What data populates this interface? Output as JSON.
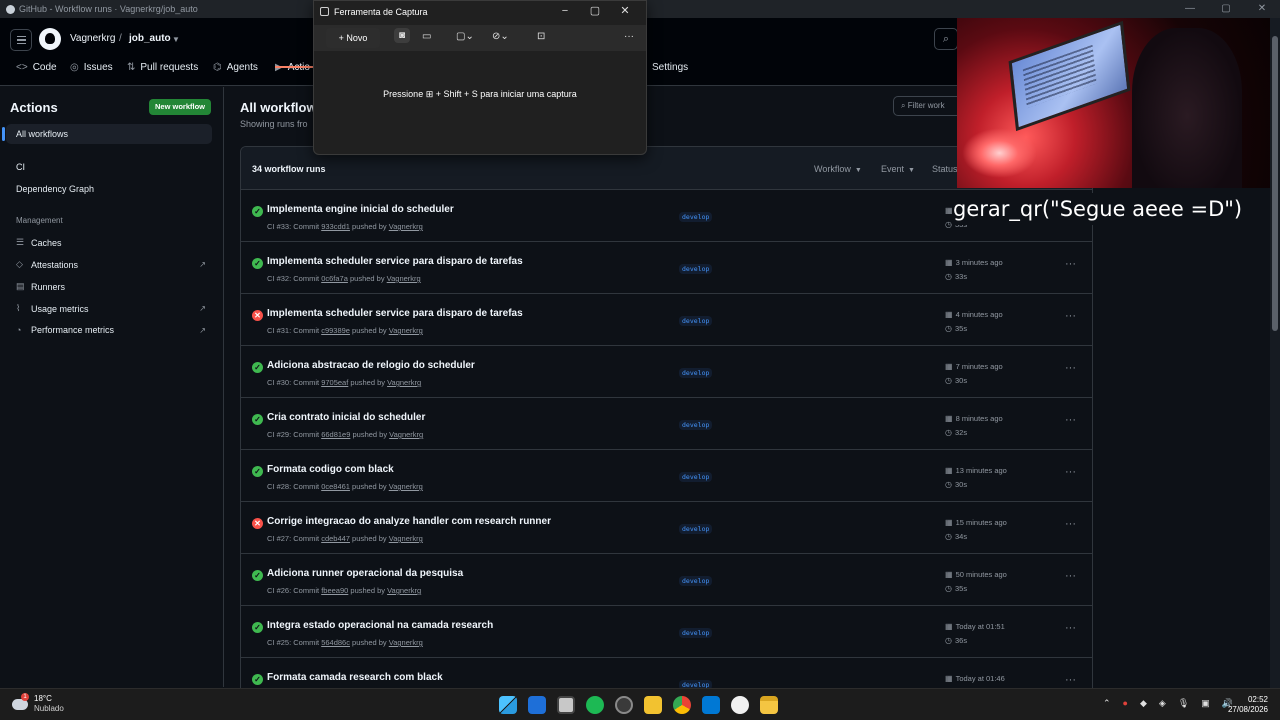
{
  "browser": {
    "tab_title": "GitHub - Workflow runs · Vagnerkrg/job_auto",
    "controls": [
      "—",
      "▢",
      "✕"
    ]
  },
  "header": {
    "owner": "Vagnerkrg",
    "slash": "/",
    "repo": "job_auto",
    "nav": [
      {
        "label": "Code",
        "icon": "code-icon"
      },
      {
        "label": "Issues",
        "icon": "issue-icon"
      },
      {
        "label": "Pull requests",
        "icon": "pull-request-icon"
      },
      {
        "label": "Agents",
        "icon": "agent-icon"
      },
      {
        "label": "Actio",
        "icon": "play-icon"
      },
      {
        "label": "Settings",
        "icon": "gear-icon"
      }
    ]
  },
  "sidebar": {
    "title": "Actions",
    "new_workflow": "New workflow",
    "all_workflows": "All workflows",
    "workflows": [
      "CI",
      "Dependency Graph"
    ],
    "management_label": "Management",
    "management": [
      {
        "label": "Caches",
        "icon": "database-icon",
        "external": false
      },
      {
        "label": "Attestations",
        "icon": "shield-check-icon",
        "external": true
      },
      {
        "label": "Runners",
        "icon": "server-icon",
        "external": false
      },
      {
        "label": "Usage metrics",
        "icon": "graph-icon",
        "external": true
      },
      {
        "label": "Performance metrics",
        "icon": "pulse-icon",
        "external": true
      }
    ]
  },
  "main": {
    "title": "All workflow",
    "subtitle": "Showing runs fro",
    "filter_placeholder": "Filter work",
    "runs_count": "34 workflow runs",
    "filters": [
      "Workflow",
      "Event",
      "Status"
    ],
    "runs": [
      {
        "status": "success",
        "title": "Implementa engine inicial do scheduler",
        "wf": "CI #33: Commit ",
        "sha": "933cdd1",
        "by": " pushed by ",
        "user": "Vagnerkrg",
        "branch": "develop",
        "time": "",
        "duration": "33s"
      },
      {
        "status": "success",
        "title": "Implementa scheduler service para disparo de tarefas",
        "wf": "CI #32: Commit ",
        "sha": "0c6fa7a",
        "by": " pushed by ",
        "user": "Vagnerkrg",
        "branch": "develop",
        "time": "3 minutes ago",
        "duration": "33s"
      },
      {
        "status": "failure",
        "title": "Implementa scheduler service para disparo de tarefas",
        "wf": "CI #31: Commit ",
        "sha": "c99389e",
        "by": " pushed by ",
        "user": "Vagnerkrg",
        "branch": "develop",
        "time": "4 minutes ago",
        "duration": "35s"
      },
      {
        "status": "success",
        "title": "Adiciona abstracao de relogio do scheduler",
        "wf": "CI #30: Commit ",
        "sha": "9705eaf",
        "by": " pushed by ",
        "user": "Vagnerkrg",
        "branch": "develop",
        "time": "7 minutes ago",
        "duration": "30s"
      },
      {
        "status": "success",
        "title": "Cria contrato inicial do scheduler",
        "wf": "CI #29: Commit ",
        "sha": "66d81e9",
        "by": " pushed by ",
        "user": "Vagnerkrg",
        "branch": "develop",
        "time": "8 minutes ago",
        "duration": "32s"
      },
      {
        "status": "success",
        "title": "Formata codigo com black",
        "wf": "CI #28: Commit ",
        "sha": "0ce8461",
        "by": " pushed by ",
        "user": "Vagnerkrg",
        "branch": "develop",
        "time": "13 minutes ago",
        "duration": "30s"
      },
      {
        "status": "failure",
        "title": "Corrige integracao do analyze handler com research runner",
        "wf": "CI #27: Commit ",
        "sha": "cdeb447",
        "by": " pushed by ",
        "user": "Vagnerkrg",
        "branch": "develop",
        "time": "15 minutes ago",
        "duration": "34s"
      },
      {
        "status": "success",
        "title": "Adiciona runner operacional da pesquisa",
        "wf": "CI #26: Commit ",
        "sha": "fbeea90",
        "by": " pushed by ",
        "user": "Vagnerkrg",
        "branch": "develop",
        "time": "50 minutes ago",
        "duration": "35s"
      },
      {
        "status": "success",
        "title": "Integra estado operacional na camada research",
        "wf": "CI #25: Commit ",
        "sha": "564d86c",
        "by": " pushed by ",
        "user": "Vagnerkrg",
        "branch": "develop",
        "time": "Today at 01:51",
        "duration": "36s"
      },
      {
        "status": "success",
        "title": "Formata camada research com black",
        "wf": "",
        "sha": "",
        "by": "",
        "user": "",
        "branch": "develop",
        "time": "Today at 01:46",
        "duration": ""
      }
    ]
  },
  "capture_tool": {
    "title": "Ferramenta de Captura",
    "new_label": "Novo",
    "message": "Pressione ⊞ + Shift + S para iniciar uma captura"
  },
  "overlay": {
    "text": "gerar_qr(\"Segue aeee =D\")"
  },
  "taskbar": {
    "temperature": "18°C",
    "condition": "Nublado",
    "weather_badge": "1",
    "time": "02:52",
    "date": "27/08/2026"
  },
  "colors": {
    "success": "#3fb950",
    "failure": "#f85149",
    "accent": "#238636",
    "link": "#4493f8"
  }
}
